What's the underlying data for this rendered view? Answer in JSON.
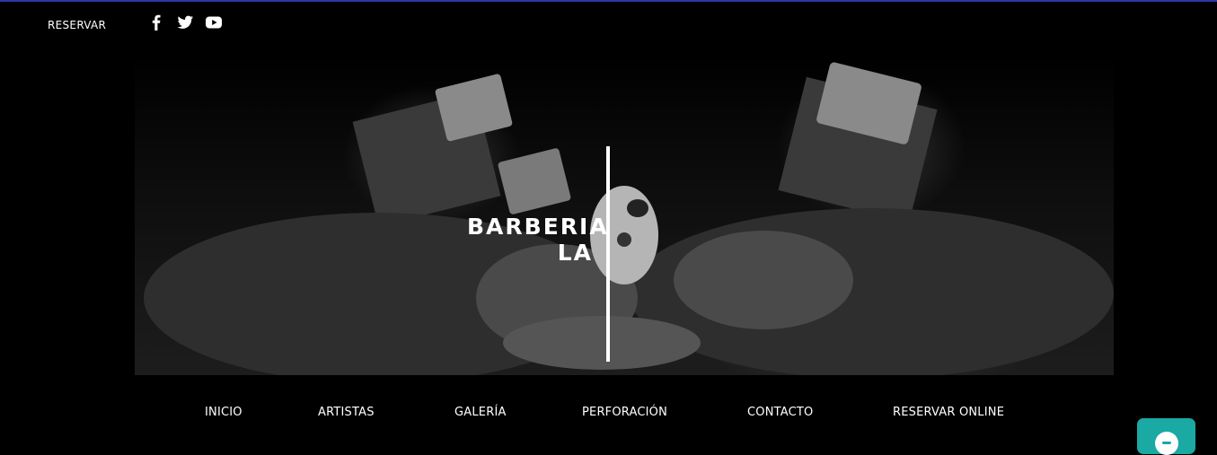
{
  "header": {
    "reserve_label": "RESERVAR",
    "social": [
      {
        "name": "facebook-icon"
      },
      {
        "name": "twitter-icon"
      },
      {
        "name": "youtube-icon"
      }
    ]
  },
  "hero": {
    "brand_line1": "BARBERIA",
    "brand_line2": "LA"
  },
  "nav": {
    "items": [
      "INICIO",
      "ARTISTAS",
      "GALERÍA",
      "PERFORACIÓN",
      "CONTACTO",
      "RESERVAR ONLINE"
    ]
  },
  "chat": {
    "icon": "chat-bubble-icon"
  },
  "colors": {
    "accent": "#1aa9a3",
    "top_border": "#2a3aa8",
    "background": "#000000"
  }
}
